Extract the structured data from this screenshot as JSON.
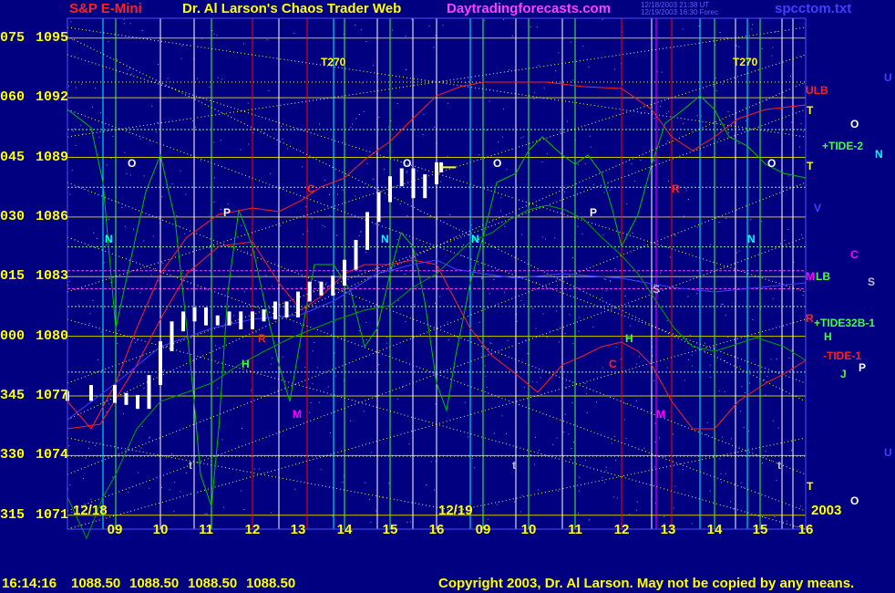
{
  "header": {
    "symbol": "S&P E-Mini",
    "title": "Dr. Al Larson's Chaos Trader Web",
    "site": "Daytradingforecasts.com",
    "timestamp1": "12/18/2003 21:38 UT",
    "timestamp2": "12/19/2003 16:30 Forec",
    "file": "spcctom.txt"
  },
  "footer": {
    "time": "16:14:16",
    "ohlc": [
      "1088.50",
      "1088.50",
      "1088.50",
      "1088.50"
    ],
    "copyright": "Copyright 2003, Dr. Al Larson. May not be copied by any means."
  },
  "colors": {
    "background": "#000080",
    "price_bars": "#ffffff",
    "grid_yellow": "#ffff00",
    "line_green": "#00c000",
    "line_red": "#ff2020",
    "vertical_cyan": "#00ffff",
    "vertical_white": "#ffffff",
    "vertical_red": "#ff0000",
    "vertical_green": "#40ff40"
  },
  "chart_data": {
    "type": "bar",
    "title": "S&P E-Mini",
    "y_axis": {
      "ticks": [
        {
          "angle": "075",
          "price": 1095
        },
        {
          "angle": "060",
          "price": 1092
        },
        {
          "angle": "045",
          "price": 1089
        },
        {
          "angle": "030",
          "price": 1086
        },
        {
          "angle": "015",
          "price": 1083
        },
        {
          "angle": "000",
          "price": 1080
        },
        {
          "angle": "345",
          "price": 1077
        },
        {
          "angle": "330",
          "price": 1074
        },
        {
          "angle": "315",
          "price": 1071
        }
      ],
      "range": [
        1070.3,
        1096.0
      ]
    },
    "x_axis": {
      "ticks": [
        "09",
        "10",
        "11",
        "12",
        "13",
        "14",
        "15",
        "16",
        "09",
        "10",
        "11",
        "12",
        "13",
        "14",
        "15",
        "16"
      ],
      "day_labels": [
        {
          "text": "12/18",
          "index": 0
        },
        {
          "text": "12/19",
          "index": 8
        }
      ],
      "year": "2003"
    },
    "price_series": [
      {
        "t": 8.5,
        "p": 1077.0
      },
      {
        "t": 8.75,
        "p": 1077.3
      },
      {
        "t": 9.0,
        "p": 1076.9
      },
      {
        "t": 9.25,
        "p": 1076.8
      },
      {
        "t": 9.5,
        "p": 1076.6
      },
      {
        "t": 9.75,
        "p": 1077.8
      },
      {
        "t": 10.0,
        "p": 1079.5
      },
      {
        "t": 10.25,
        "p": 1080.5
      },
      {
        "t": 10.5,
        "p": 1081.0
      },
      {
        "t": 10.75,
        "p": 1081.2
      },
      {
        "t": 11.0,
        "p": 1080.8
      },
      {
        "t": 11.25,
        "p": 1080.8
      },
      {
        "t": 11.5,
        "p": 1081.0
      },
      {
        "t": 11.75,
        "p": 1080.6
      },
      {
        "t": 12.0,
        "p": 1081.0
      },
      {
        "t": 12.25,
        "p": 1081.1
      },
      {
        "t": 12.5,
        "p": 1081.5
      },
      {
        "t": 12.75,
        "p": 1081.2
      },
      {
        "t": 13.0,
        "p": 1082.0
      },
      {
        "t": 13.25,
        "p": 1082.5
      },
      {
        "t": 13.5,
        "p": 1082.3
      },
      {
        "t": 13.75,
        "p": 1082.8
      },
      {
        "t": 14.0,
        "p": 1083.6
      },
      {
        "t": 14.25,
        "p": 1084.6
      },
      {
        "t": 14.5,
        "p": 1086.0
      },
      {
        "t": 14.75,
        "p": 1087.0
      },
      {
        "t": 15.0,
        "p": 1087.8
      },
      {
        "t": 15.25,
        "p": 1088.2
      },
      {
        "t": 15.5,
        "p": 1087.2
      },
      {
        "t": 15.75,
        "p": 1087.9
      },
      {
        "t": 16.0,
        "p": 1088.5
      },
      {
        "t": 16.1,
        "p": 1088.5
      }
    ],
    "annotations": {
      "top_labels": [
        "T270",
        "T270"
      ],
      "right_labels": [
        {
          "text": "U",
          "color": "#4040ff"
        },
        {
          "text": "ULB",
          "color": "#ff2020"
        },
        {
          "text": "T",
          "color": "#ffff00"
        },
        {
          "text": "O",
          "color": "#ffffff"
        },
        {
          "text": "+TIDE-2",
          "color": "#40ff40"
        },
        {
          "text": "N",
          "color": "#00ffff"
        },
        {
          "text": "T",
          "color": "#ffff00"
        },
        {
          "text": "V",
          "color": "#4040ff"
        },
        {
          "text": "C",
          "color": "#ff00ff"
        },
        {
          "text": "M",
          "color": "#ff00ff"
        },
        {
          "text": "LB",
          "color": "#40ff40"
        },
        {
          "text": "S",
          "color": "#c0c0c0"
        },
        {
          "text": "R",
          "color": "#ff2020"
        },
        {
          "text": "+TIDE32B-1",
          "color": "#40ff40"
        },
        {
          "text": "H",
          "color": "#40ff40"
        },
        {
          "text": "-TIDE-1",
          "color": "#ff2020"
        },
        {
          "text": "J",
          "color": "#40ff40"
        },
        {
          "text": "P",
          "color": "#ffffff"
        },
        {
          "text": "U",
          "color": "#4040ff"
        },
        {
          "text": "T",
          "color": "#ffff00"
        },
        {
          "text": "O",
          "color": "#ffffff"
        }
      ],
      "plot_letters": [
        {
          "text": "O",
          "color": "#ffffff"
        },
        {
          "text": "N",
          "color": "#00ffff"
        },
        {
          "text": "P",
          "color": "#ffffff"
        },
        {
          "text": "C",
          "color": "#ff2020"
        },
        {
          "text": "R",
          "color": "#ff2020"
        },
        {
          "text": "H",
          "color": "#40ff40"
        },
        {
          "text": "M",
          "color": "#ff00ff"
        },
        {
          "text": "N",
          "color": "#00ffff"
        },
        {
          "text": "O",
          "color": "#ffffff"
        },
        {
          "text": "O",
          "color": "#ffffff"
        },
        {
          "text": "N",
          "color": "#00ffff"
        },
        {
          "text": "P",
          "color": "#ffffff"
        },
        {
          "text": "S",
          "color": "#c0c0c0"
        },
        {
          "text": "R",
          "color": "#ff2020"
        },
        {
          "text": "H",
          "color": "#40ff40"
        },
        {
          "text": "C",
          "color": "#ff2020"
        },
        {
          "text": "M",
          "color": "#ff00ff"
        },
        {
          "text": "N",
          "color": "#00ffff"
        },
        {
          "text": "O",
          "color": "#ffffff"
        },
        {
          "text": "t",
          "color": "#c0c0c0"
        },
        {
          "text": "t",
          "color": "#c0c0c0"
        },
        {
          "text": "t",
          "color": "#c0c0c0"
        }
      ]
    },
    "grid": true
  }
}
